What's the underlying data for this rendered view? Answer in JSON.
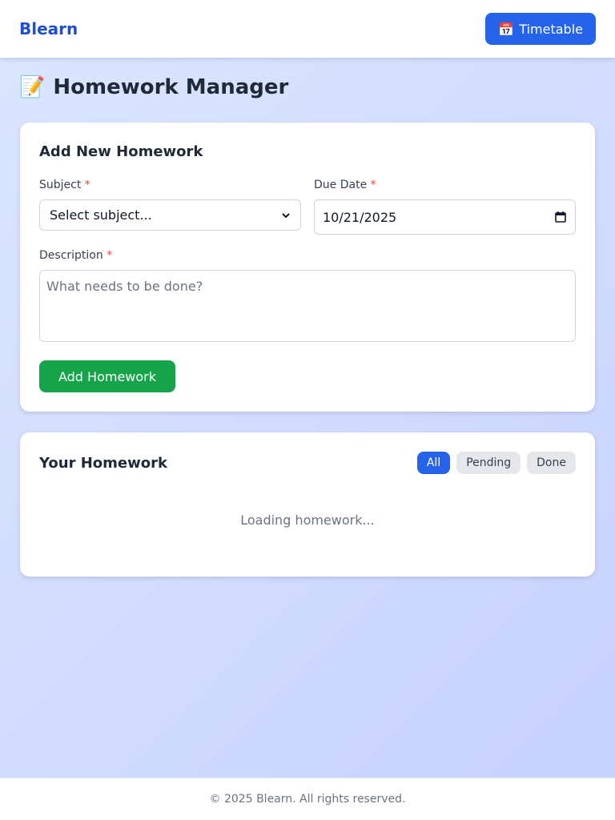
{
  "header": {
    "brand": "Blearn",
    "timetable_icon": "📅",
    "timetable_label": "Timetable"
  },
  "page": {
    "title_icon": "📝",
    "title": "Homework Manager"
  },
  "add_form": {
    "title": "Add New Homework",
    "subject_label": "Subject",
    "subject_value": "Select subject...",
    "due_date_label": "Due Date",
    "due_date_value": "10/21/2025",
    "description_label": "Description",
    "description_placeholder": "What needs to be done?",
    "required_marker": "*",
    "submit_label": "Add Homework"
  },
  "list": {
    "title": "Your Homework",
    "filters": [
      "All",
      "Pending",
      "Done"
    ],
    "active_filter": "All",
    "loading_text": "Loading homework..."
  },
  "footer": {
    "text": "© 2025 Blearn. All rights reserved."
  },
  "colors": {
    "primary": "#2563eb",
    "success": "#16a34a",
    "required": "#ef4444"
  }
}
